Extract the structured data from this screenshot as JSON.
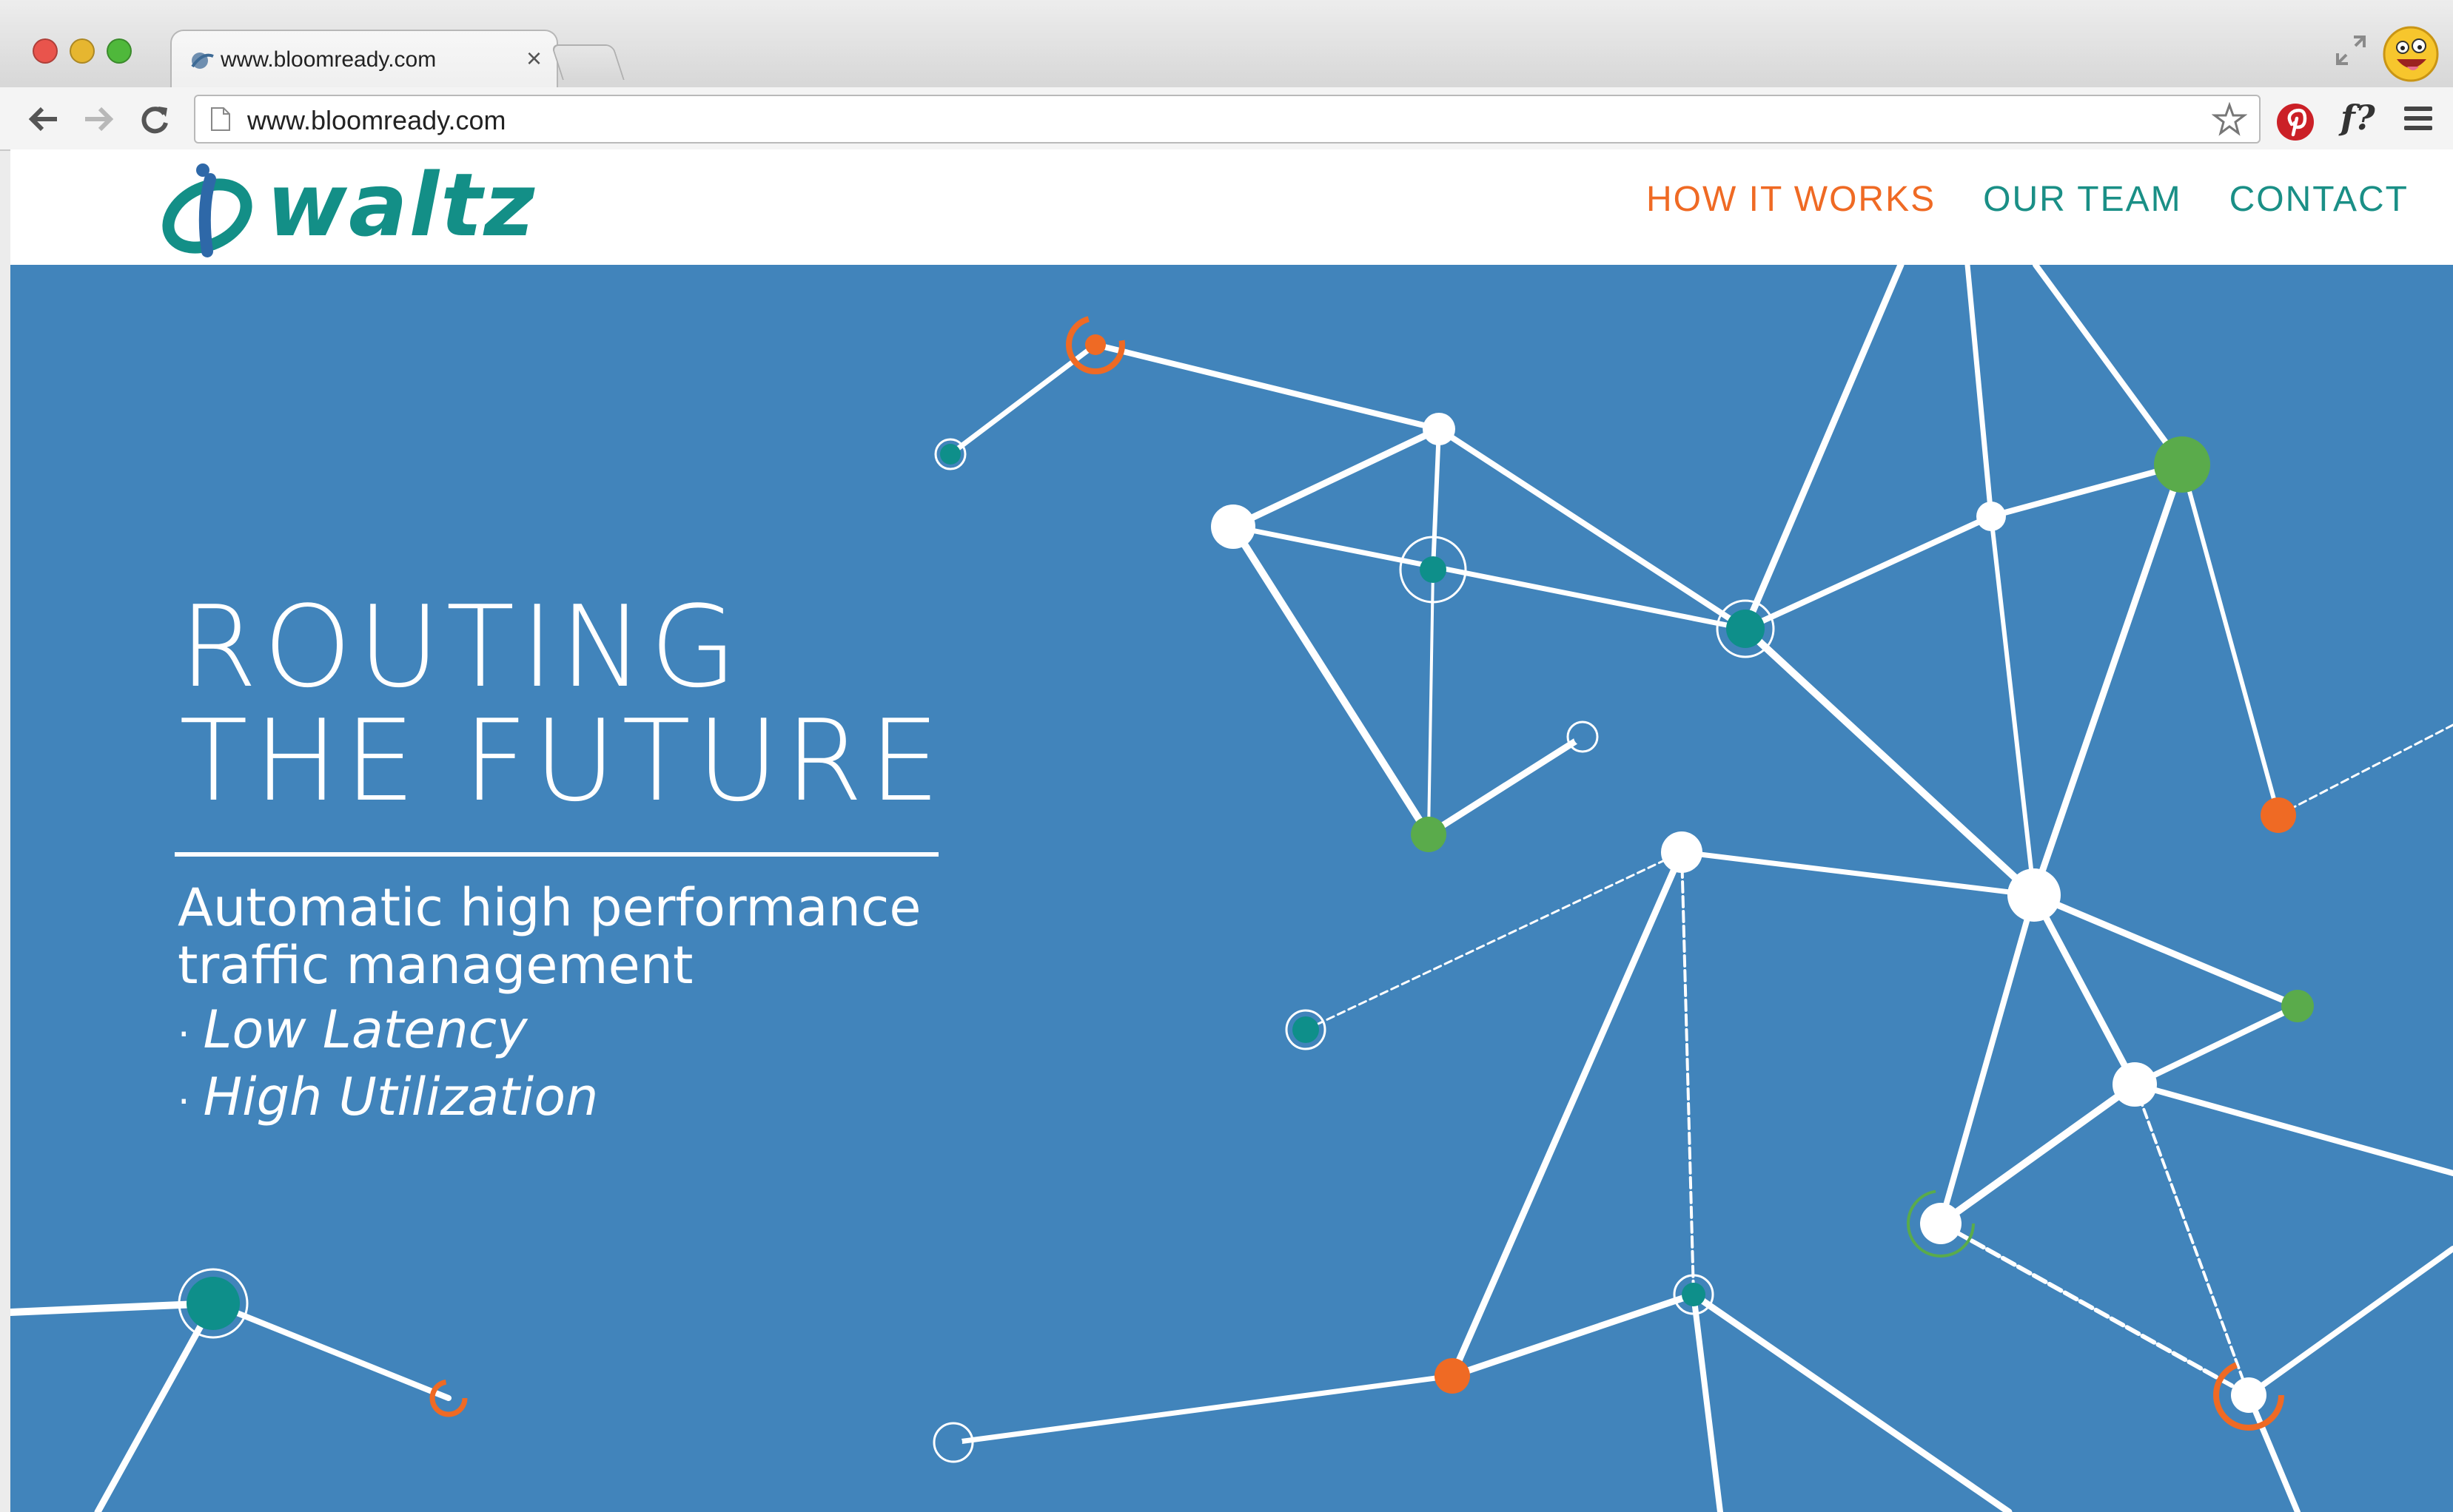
{
  "browser": {
    "tab_title": "www.bloomready.com",
    "tab_close": "×",
    "url": "www.bloomready.com",
    "extension_fonts": "f?",
    "icons": [
      "close-window-icon",
      "minimize-window-icon",
      "zoom-window-icon",
      "favicon-icon",
      "fullscreen-icon",
      "profile-icon",
      "back-arrow-icon",
      "forward-arrow-icon",
      "reload-icon",
      "page-icon",
      "bookmark-star-icon",
      "pinterest-icon",
      "whatfont-icon",
      "menu-icon"
    ]
  },
  "site": {
    "logo_text": "waltz",
    "nav": [
      {
        "label": "HOW IT WORKS",
        "active": true
      },
      {
        "label": "OUR TEAM",
        "active": false
      },
      {
        "label": "CONTACT",
        "active": false
      }
    ]
  },
  "hero": {
    "headline_line1": "ROUTING",
    "headline_line2": "THE FUTURE",
    "subline_line1": "Automatic high performance",
    "subline_line2": "traffic management",
    "bullets": [
      "Low Latency",
      "High Utilization"
    ],
    "bullet_marker": "·"
  },
  "colors": {
    "hero_bg": "#4184bb",
    "brand_teal": "#138f87",
    "accent_orange": "#ef6a24",
    "node_green": "#5aab4b",
    "node_teal": "#0e8f8a",
    "line_white": "#ffffff"
  }
}
